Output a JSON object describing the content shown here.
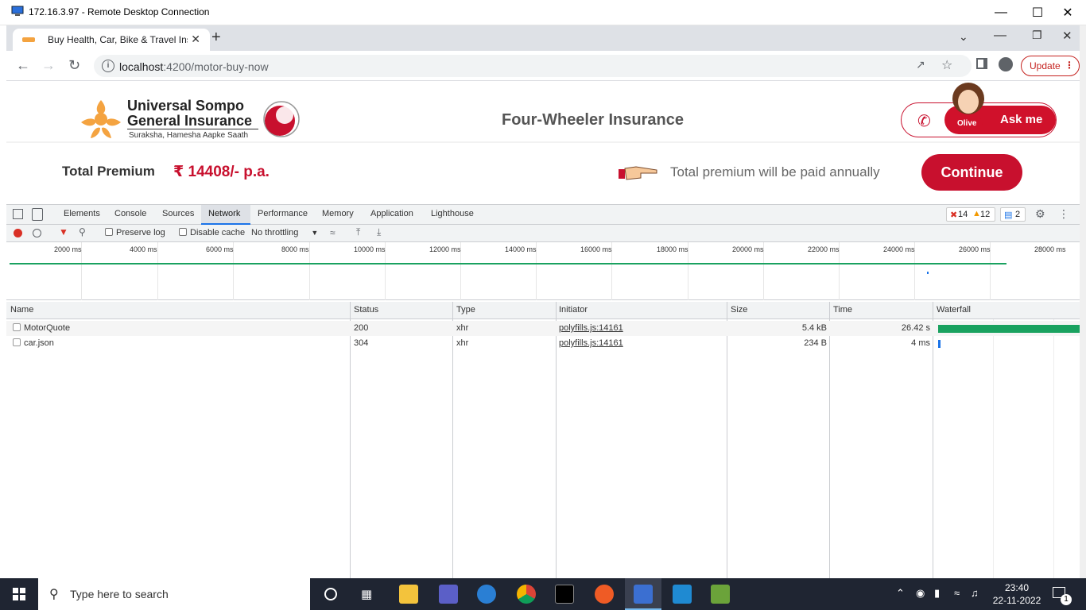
{
  "rdp": {
    "title": "172.16.3.97 - Remote Desktop Connection"
  },
  "browser": {
    "tab_title": "Buy Health, Car, Bike & Travel Ins",
    "url_host": "localhost",
    "url_path": ":4200/motor-buy-now",
    "update_label": "Update"
  },
  "page": {
    "brand_line1": "Universal Sompo",
    "brand_line2": "General Insurance",
    "brand_tagline": "Suraksha, Hamesha Aapke Saath",
    "title": "Four-Wheeler Insurance",
    "ask_label": "Ask me",
    "olive_label": "Olive",
    "premium_label": "Total Premium",
    "premium_value": "₹ 14408/- p.a.",
    "premium_note": "Total premium will be paid annually",
    "continue_label": "Continue"
  },
  "devtools": {
    "tabs": [
      "Elements",
      "Console",
      "Sources",
      "Network",
      "Performance",
      "Memory",
      "Application",
      "Lighthouse"
    ],
    "active_tab": "Network",
    "errors_count": "14",
    "warnings_count": "12",
    "issues_count": "2",
    "toolbar": {
      "preserve_log": "Preserve log",
      "disable_cache": "Disable cache",
      "throttling": "No throttling"
    },
    "timeline_ticks": [
      "2000 ms",
      "4000 ms",
      "6000 ms",
      "8000 ms",
      "10000 ms",
      "12000 ms",
      "14000 ms",
      "16000 ms",
      "18000 ms",
      "20000 ms",
      "22000 ms",
      "24000 ms",
      "26000 ms",
      "28000 ms"
    ],
    "columns": [
      "Name",
      "Status",
      "Type",
      "Initiator",
      "Size",
      "Time",
      "Waterfall"
    ],
    "rows": [
      {
        "name": "MotorQuote",
        "status": "200",
        "type": "xhr",
        "initiator": "polyfills.js:14161",
        "size": "5.4 kB",
        "time": "26.42 s"
      },
      {
        "name": "car.json",
        "status": "304",
        "type": "xhr",
        "initiator": "polyfills.js:14161",
        "size": "234 B",
        "time": "4 ms"
      }
    ]
  },
  "taskbar": {
    "search_placeholder": "Type here to search",
    "time": "23:40",
    "date": "22-11-2022",
    "notification_count": "1"
  },
  "colors": {
    "brand_red": "#c8102e",
    "brand_orange": "#f4a340",
    "devtools_blue": "#1a73e8",
    "network_green": "#1aa260"
  }
}
